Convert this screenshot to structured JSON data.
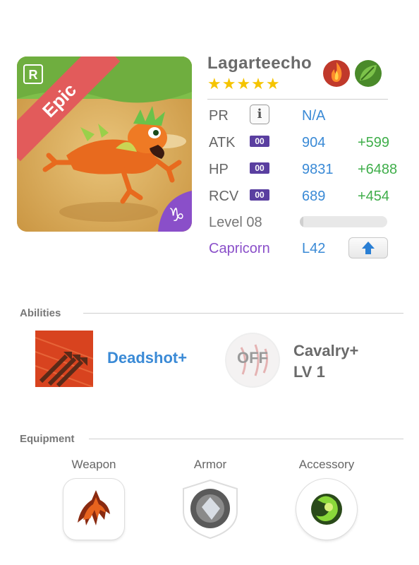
{
  "monster": {
    "name": "Lagarteecho",
    "rarity": "Epic",
    "rarity_icon": "R",
    "stars": "★★★★★",
    "element_icons": [
      "fire-icon",
      "leaf-icon"
    ],
    "zodiac_symbol": "♑"
  },
  "stats": {
    "pr": {
      "label": "PR",
      "info": "i",
      "value": "N/A"
    },
    "atk": {
      "label": "ATK",
      "badge": "00",
      "value": "904",
      "bonus": "+599"
    },
    "hp": {
      "label": "HP",
      "badge": "00",
      "value": "9831",
      "bonus": "+6488"
    },
    "rcv": {
      "label": "RCV",
      "badge": "00",
      "value": "689",
      "bonus": "+454"
    },
    "level": {
      "label": "Level 08"
    },
    "sign": {
      "label": "Capricorn",
      "value": "L42"
    }
  },
  "abilities": {
    "title": "Abilities",
    "ability1": {
      "name": "Deadshot+"
    },
    "ability2": {
      "state": "OFF",
      "name_line1": "Cavalry+",
      "name_line2": "LV 1"
    }
  },
  "equipment": {
    "title": "Equipment",
    "slots": [
      {
        "label": "Weapon"
      },
      {
        "label": "Armor"
      },
      {
        "label": "Accessory"
      }
    ]
  },
  "colors": {
    "accent_blue": "#3a8ad6",
    "bonus_green": "#3fae4a",
    "epic_banner": "#e25b5b",
    "zodiac_purple": "#8a4fc9",
    "badge_purple": "#5a3fa0",
    "star_yellow": "#f5c400"
  }
}
